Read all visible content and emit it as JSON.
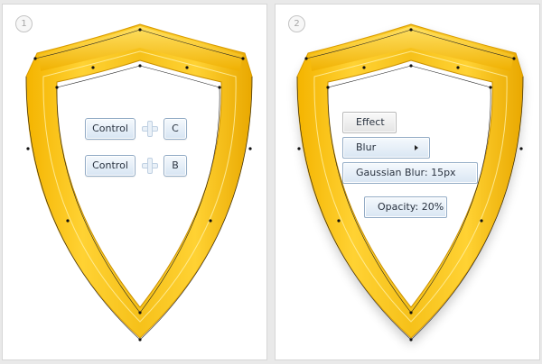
{
  "steps": [
    {
      "number": "1",
      "shortcuts": [
        {
          "modifier": "Control",
          "key": "C"
        },
        {
          "modifier": "Control",
          "key": "B"
        }
      ]
    },
    {
      "number": "2",
      "menu": {
        "effect": "Effect",
        "blur": "Blur",
        "gaussian": "Gaussian Blur: 15px",
        "opacity": "Opacity: 20%"
      }
    }
  ],
  "colors": {
    "shield_outer": "#f1b800",
    "shield_light": "#ffe46a",
    "shield_dark": "#d79a00",
    "button_border": "#93acc6"
  },
  "icons": [
    "plus-icon",
    "arrow-right-icon"
  ]
}
